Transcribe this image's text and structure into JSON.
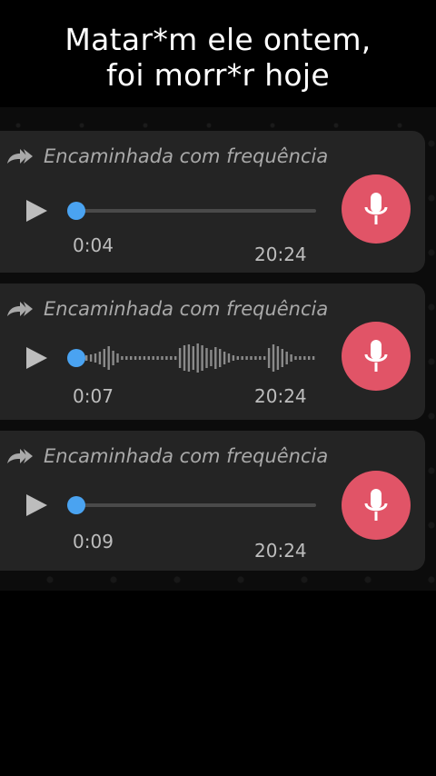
{
  "caption": {
    "line1": "Matar*m ele ontem,",
    "line2": "foi morr*r hoje"
  },
  "colors": {
    "bubble": "#242424",
    "progress_knob": "#4aa3f1",
    "mic_button": "#e15467",
    "label_text": "#a9a9a9"
  },
  "messages": [
    {
      "forwarded_label": "Encaminhada com frequência",
      "duration": "0:04",
      "time": "20:24",
      "progress": 0,
      "waveform_visible": false
    },
    {
      "forwarded_label": "Encaminhada com frequência",
      "duration": "0:07",
      "time": "20:24",
      "progress": 0,
      "waveform_visible": true
    },
    {
      "forwarded_label": "Encaminhada com frequência",
      "duration": "0:09",
      "time": "20:24",
      "progress": 0,
      "waveform_visible": false
    }
  ],
  "icons": [
    "forwarded-icon",
    "play-icon",
    "microphone-icon"
  ]
}
